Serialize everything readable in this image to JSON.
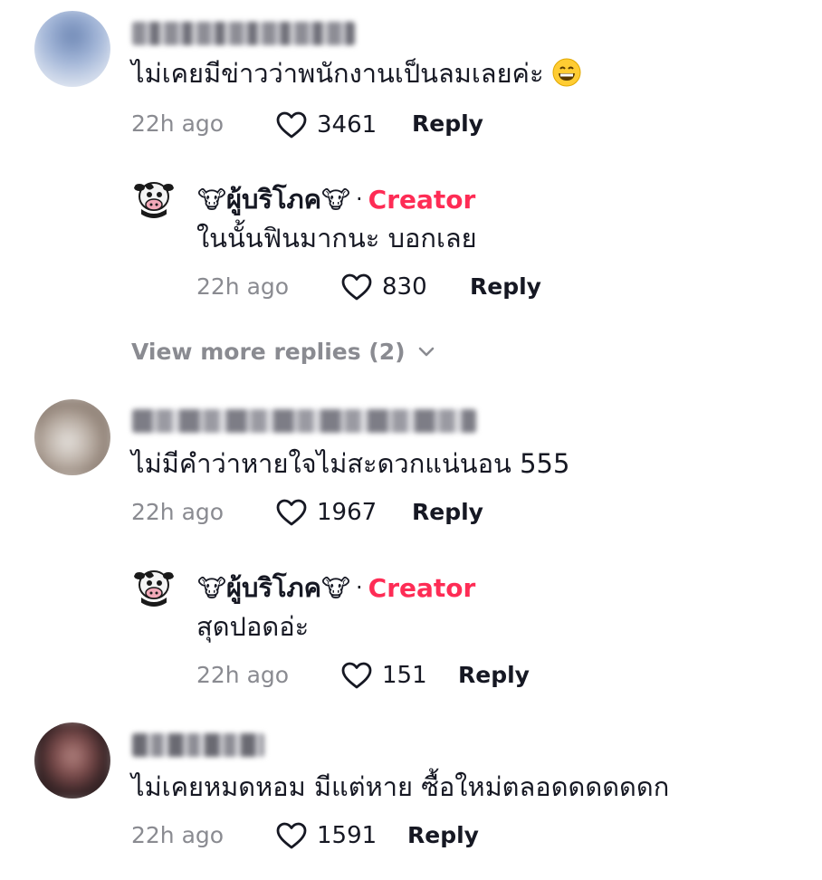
{
  "comments": [
    {
      "text": "ไม่เคยมีข่าวว่าพนักงานเป็นลมเลยค่ะ",
      "emoji": "grinning-face-emoji",
      "time": "22h ago",
      "likes": "3461",
      "reply_label": "Reply",
      "reply": {
        "author": "ผู้บริโภค",
        "author_emoji": "🐮",
        "badge": "Creator",
        "separator": "·",
        "text": "ในนั้นฟินมากนะ บอกเลย",
        "time": "22h ago",
        "likes": "830",
        "reply_label": "Reply"
      },
      "view_more": "View more replies (2)"
    },
    {
      "text": "ไม่มีคำว่าหายใจไม่สะดวกแน่นอน 555",
      "time": "22h ago",
      "likes": "1967",
      "reply_label": "Reply",
      "reply": {
        "author": "ผู้บริโภค",
        "author_emoji": "🐮",
        "badge": "Creator",
        "separator": "·",
        "text": "สุดปอดอ่ะ",
        "time": "22h ago",
        "likes": "151",
        "reply_label": "Reply"
      }
    },
    {
      "text": "ไม่เคยหมดหอม มีแต่หาย ซื้อใหม่ตลอดดดดดดก",
      "time": "22h ago",
      "likes": "1591",
      "reply_label": "Reply"
    }
  ],
  "icons": {
    "like": "heart-outline-icon",
    "expand": "chevron-down-icon"
  },
  "colors": {
    "creator_badge": "#fe2c55",
    "muted_text": "#8a8b91",
    "primary_text": "#161823"
  }
}
